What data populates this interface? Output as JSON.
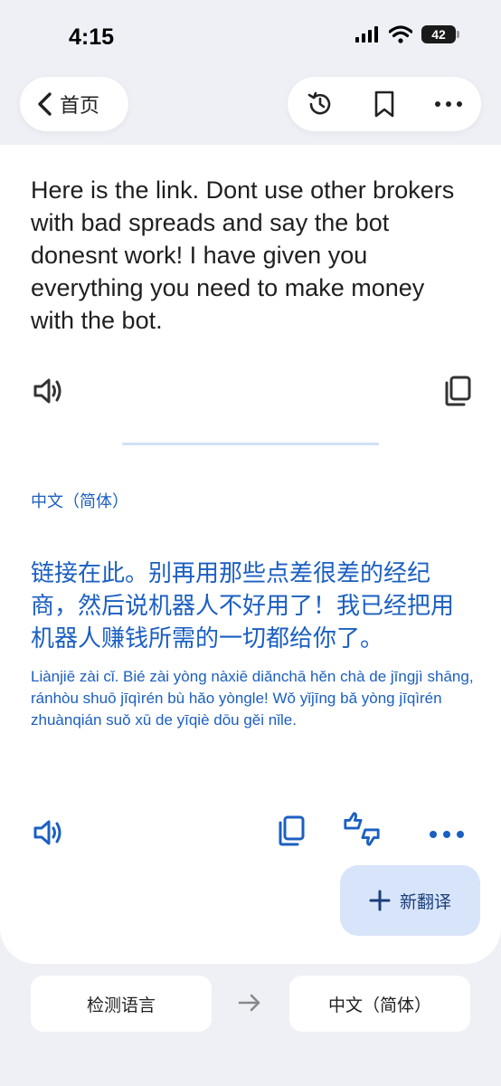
{
  "status_bar": {
    "time": "4:15",
    "battery": "42"
  },
  "header": {
    "back_label": "首页"
  },
  "source": {
    "text": "Here is the link. Dont use other brokers with bad spreads and say the bot donesnt work! I have given you everything you need to make money with the bot."
  },
  "target": {
    "language": "中文（简体）",
    "translation": "链接在此。别再用那些点差很差的经纪商，然后说机器人不好用了！我已经把用机器人赚钱所需的一切都给你了。",
    "pinyin": "Liànjiē zài cǐ. Bié zài yòng nàxiē diǎnchā hěn chà de jīngjì shāng, ránhòu shuō jīqìrén bù hǎo yòngle! Wǒ yǐjīng bǎ yòng jīqìrén zhuànqián suǒ xū de yīqiè dōu gěi nǐle."
  },
  "fab": {
    "label": "新翻译"
  },
  "language_bar": {
    "source_label": "检测语言",
    "target_label": "中文（简体）"
  },
  "colors": {
    "accent": "#1b5fc1",
    "fab_bg": "#d8e4f9",
    "background": "#eef0f5"
  },
  "icons": [
    "signal-icon",
    "wifi-icon",
    "battery-icon",
    "back-chevron-icon",
    "history-icon",
    "bookmark-icon",
    "more-icon",
    "speaker-icon",
    "copy-icon",
    "feedback-icon",
    "plus-icon",
    "arrow-right-icon"
  ]
}
